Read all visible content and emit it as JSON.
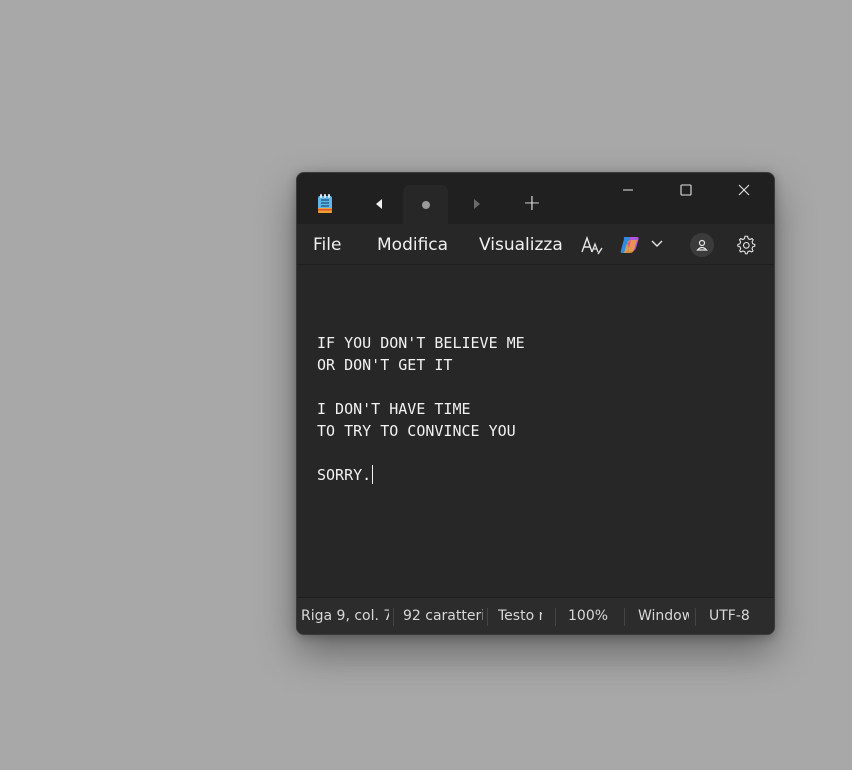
{
  "window": {
    "tabs": [
      {
        "state": "unsaved"
      }
    ],
    "new_tab_label": "+"
  },
  "menu": {
    "file": "File",
    "edit": "Modifica",
    "view": "Visualizza"
  },
  "toolbar": {
    "icons": [
      "text-format-icon",
      "copilot-icon",
      "chevron-down-icon",
      "account-icon",
      "settings-gear-icon"
    ]
  },
  "editor": {
    "content": "IF YOU DON'T BELIEVE ME\nOR DON'T GET IT\n\nI DON'T HAVE TIME\nTO TRY TO CONVINCE YOU\n\nSORRY.",
    "caret_line": 9,
    "caret_col": 7
  },
  "status": {
    "position": "Riga 9, col. 7",
    "characters": "92 caratteri",
    "format": "Testo r",
    "zoom": "100%",
    "line_ending": "Window",
    "encoding": "UTF-8"
  },
  "colors": {
    "desktop": "#a8a8a8",
    "titlebar": "#202020",
    "editor_bg": "#272727",
    "text": "#f2f2f2"
  }
}
